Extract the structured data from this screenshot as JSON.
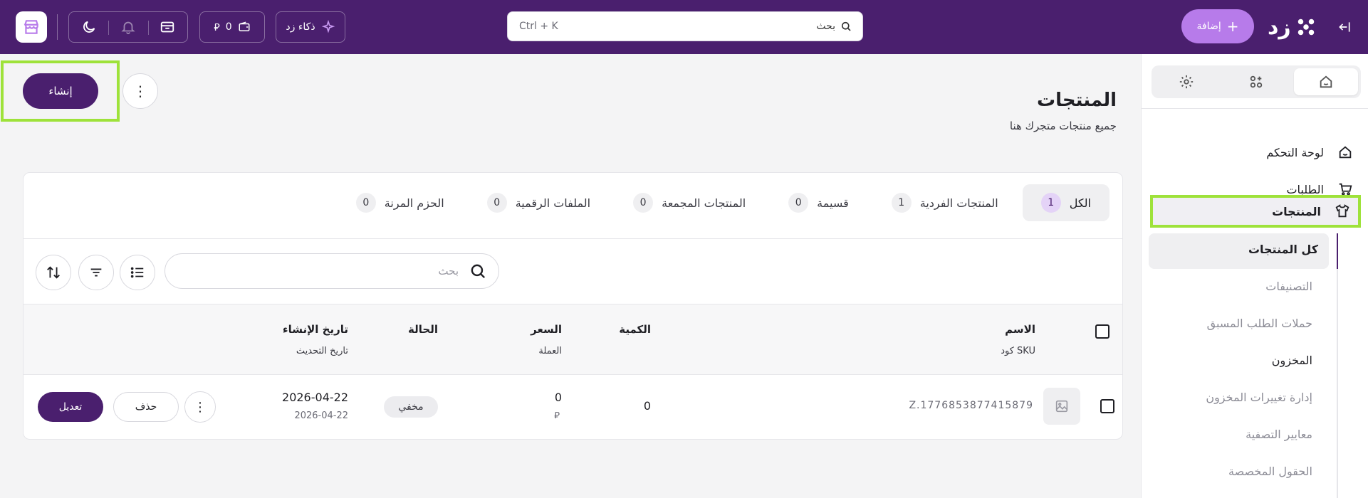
{
  "topbar": {
    "wallet_amount": "0",
    "currency_symbol": "⃁",
    "ai_label": "ذكاء زد",
    "search_label": "بحث",
    "search_shortcut": "Ctrl + K",
    "add_label": "إضافة",
    "logo_text": "زد",
    "icons": [
      "store-icon",
      "moon-icon",
      "bell-icon",
      "ticket-icon",
      "wallet-icon",
      "sparkle-icon",
      "search-icon",
      "plus-icon",
      "logo-icon",
      "collapse-icon"
    ]
  },
  "sidebar": {
    "tabs": [
      "home-icon",
      "apps-icon",
      "gear-icon"
    ],
    "items": [
      {
        "label": "لوحة التحكم",
        "icon": "home-icon"
      },
      {
        "label": "الطلبات",
        "icon": "cart-icon"
      },
      {
        "label": "المنتجات",
        "icon": "shirt-icon"
      }
    ],
    "sub_items": [
      {
        "label": "كل المنتجات"
      },
      {
        "label": "التصنيفات"
      },
      {
        "label": "حملات الطلب المسبق"
      },
      {
        "label": "المخزون"
      },
      {
        "label": "إدارة تغييرات المخزون"
      },
      {
        "label": "معايير التصفية"
      },
      {
        "label": "الحقول المخصصة"
      }
    ]
  },
  "page": {
    "title": "المنتجات",
    "subtitle": "جميع منتجات متجرك هنا",
    "create_label": "إنشاء",
    "more_label": "⋮"
  },
  "tabs": [
    {
      "label": "الكل",
      "count": "1"
    },
    {
      "label": "المنتجات الفردية",
      "count": "1"
    },
    {
      "label": "قسيمة",
      "count": "0"
    },
    {
      "label": "المنتجات المجمعة",
      "count": "0"
    },
    {
      "label": "الملفات الرقمية",
      "count": "0"
    },
    {
      "label": "الحزم المرنة",
      "count": "0"
    }
  ],
  "search": {
    "placeholder": "بحث"
  },
  "table": {
    "headers": {
      "name": "الاسم",
      "sku": "كود SKU",
      "quantity": "الكمية",
      "price": "السعر",
      "currency": "العملة",
      "status": "الحالة",
      "created": "تاريخ الإنشاء",
      "updated": "تاريخ التحديث"
    },
    "rows": [
      {
        "sku": "Z.1776853877415879",
        "quantity": "0",
        "price": "0",
        "currency": "⃁",
        "status": "مخفي",
        "created": "2026-04-22",
        "updated": "2026-04-22",
        "delete_label": "حذف",
        "edit_label": "تعديل",
        "more_label": "⋮"
      }
    ]
  },
  "colors": {
    "brand": "#4a1f6e",
    "accent": "#b77bea",
    "highlight": "#9ee23a"
  }
}
